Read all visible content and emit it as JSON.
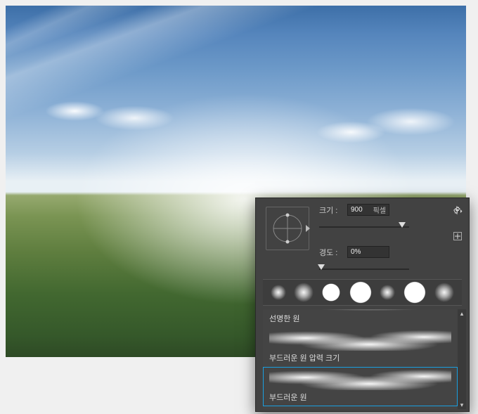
{
  "size": {
    "label": "크기 :",
    "value": "900",
    "unit": "픽셀"
  },
  "hardness": {
    "label": "경도 :",
    "value": "0%"
  },
  "slider": {
    "size_pos_pct": 92,
    "hard_pos_pct": 2
  },
  "icons": {
    "gear": "gear-icon",
    "new_preset": "plus-icon"
  },
  "preset_dots": [
    {
      "cls": "soft tiny"
    },
    {
      "cls": "soft mid"
    },
    {
      "cls": "hard mid"
    },
    {
      "cls": "hard big"
    },
    {
      "cls": "soft tiny"
    },
    {
      "cls": "hard big"
    },
    {
      "cls": "soft mid"
    }
  ],
  "brushes": [
    {
      "label": "선명한 원",
      "style": "sharp",
      "selected": false
    },
    {
      "label": "부드러운 원 압력 크기",
      "style": "soft",
      "selected": false
    },
    {
      "label": "부드러운 원",
      "style": "soft",
      "selected": true
    }
  ]
}
